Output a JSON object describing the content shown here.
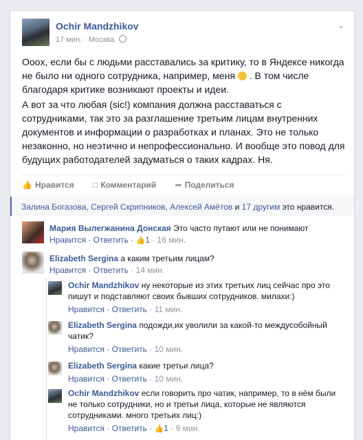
{
  "post": {
    "author": "Ochir Mandzhikov",
    "time": "17 мин.",
    "location": "Москва",
    "paragraph1_a": "Оооx, если бы с людьми расставались за критику, то в Яндексе никогда не было ни одного сотрудника, например, меня",
    "paragraph1_b": ". В том числе благодаря критике возникают проекты и идеи.",
    "paragraph2": "А вот за что любая (sic!) компания должна расставаться с сотрудниками, так это за разглашение третьим лицам внутренних документов и информации о разработках и планах. Это не только незаконно, но неэтично и непрофессионально. И вообще это повод для будущих работодателей задуматься о таких кадрах. Ня."
  },
  "actions": {
    "like": "Нравится",
    "comment": "Комментарий",
    "share": "Поделиться"
  },
  "likes": {
    "names": "Залина Богазова, Сергей Скрипников, Алексей Амётов",
    "and": "и",
    "others": "17 другим",
    "suffix": "это нравится."
  },
  "comments": [
    {
      "author": "Мария Вылегжанина Донская",
      "text": "Это часто путают или не понимают",
      "like": "Нравится",
      "reply": "Ответить",
      "likes_count": "1",
      "time": "16 мин."
    },
    {
      "author": "Elizabeth Sergina",
      "text": "а каким третьим лицам?",
      "like": "Нравится",
      "reply": "Ответить",
      "time": "14 мин."
    }
  ],
  "replies": [
    {
      "author": "Ochir Mandzhikov",
      "text": "ну некоторые из этих третьих лиц сейчас про это пишут и подставляют своих бывших сотрудников. милахи:)",
      "like": "Нравится",
      "reply": "Ответить",
      "time": "11 мин."
    },
    {
      "author": "Elizabeth Sergina",
      "text": "подожди,их уволили за какой-то междусобойный чатик?",
      "like": "Нравится",
      "reply": "Ответить",
      "time": "10 мин."
    },
    {
      "author": "Elizabeth Sergina",
      "text": "какие третьи лица?",
      "like": "Нравится",
      "reply": "Ответить",
      "time": "10 мин."
    },
    {
      "author": "Ochir Mandzhikov",
      "text": "если говорить про чатик, например, то в нём были не только сотрудники, но и третьи лица, которые не являются сотрудниками. много третьих лиц:)",
      "like": "Нравится",
      "reply": "Ответить",
      "likes_count": "1",
      "time": "9 мин."
    }
  ]
}
